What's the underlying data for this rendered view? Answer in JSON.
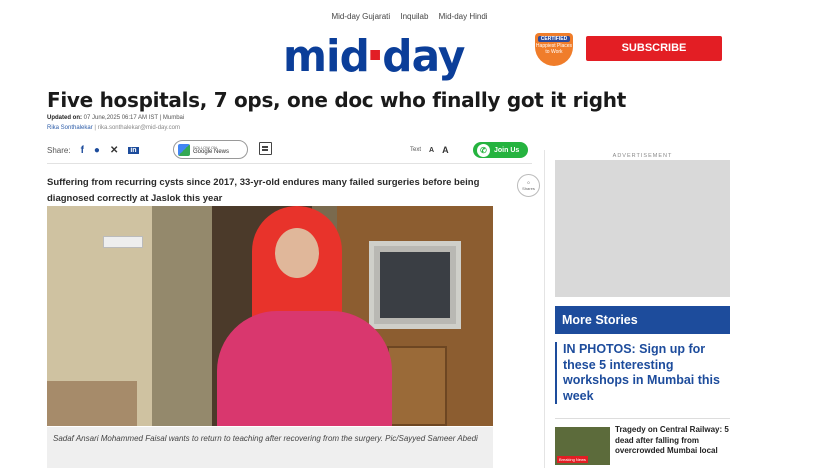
{
  "top_nav": [
    "Mid-day Gujarati",
    "Inquilab",
    "Mid-day Hindi"
  ],
  "logo": {
    "part1": "mid",
    "part2": "day"
  },
  "certified": {
    "line1": "CERTIFIED",
    "line2": "Happiest Places to Work"
  },
  "subscribe_label": "SUBSCRIBE",
  "article": {
    "headline": "Five hospitals, 7 ops, one doc who finally got it right",
    "updated_label": "Updated on:",
    "updated_value": "07 June,2025 06:17 AM IST",
    "location": "Mumbai",
    "author": "Rika Sonthalekar",
    "author_email": "rika.sonthalekar@mid-day.com",
    "summary": "Suffering from recurring cysts since 2017, 33-yr-old endures many failed surgeries before being diagnosed correctly at Jaslok this year",
    "caption": "Sadaf Ansari Mohammed Faisal wants to return to teaching after recovering from the surgery. Pic/Sayyed Sameer Abedi"
  },
  "share": {
    "label": "Share:",
    "icons": [
      "facebook-icon",
      "whatsapp-icon",
      "x-icon",
      "linkedin-icon"
    ],
    "google_news_top": "FOLLOW ON",
    "google_news": "Google News"
  },
  "text_size": {
    "label": "Text",
    "small": "A",
    "large": "A"
  },
  "join_us": "Join Us",
  "comments": {
    "count": "0",
    "label": "Shares"
  },
  "sidebar": {
    "ad_label": "ADVERTISEMENT",
    "more_stories_title": "More Stories",
    "story1": "IN PHOTOS: Sign up for these 5 interesting workshops in Mumbai this week",
    "story2": "Tragedy on Central Railway: 5 dead after falling from overcrowded Mumbai local",
    "story2_badge": "Breaking News"
  },
  "colors": {
    "brand_blue": "#0b3e99",
    "brand_red": "#e31e24",
    "whatsapp_green": "#25b33f",
    "sidebar_blue": "#1d4c9c"
  }
}
